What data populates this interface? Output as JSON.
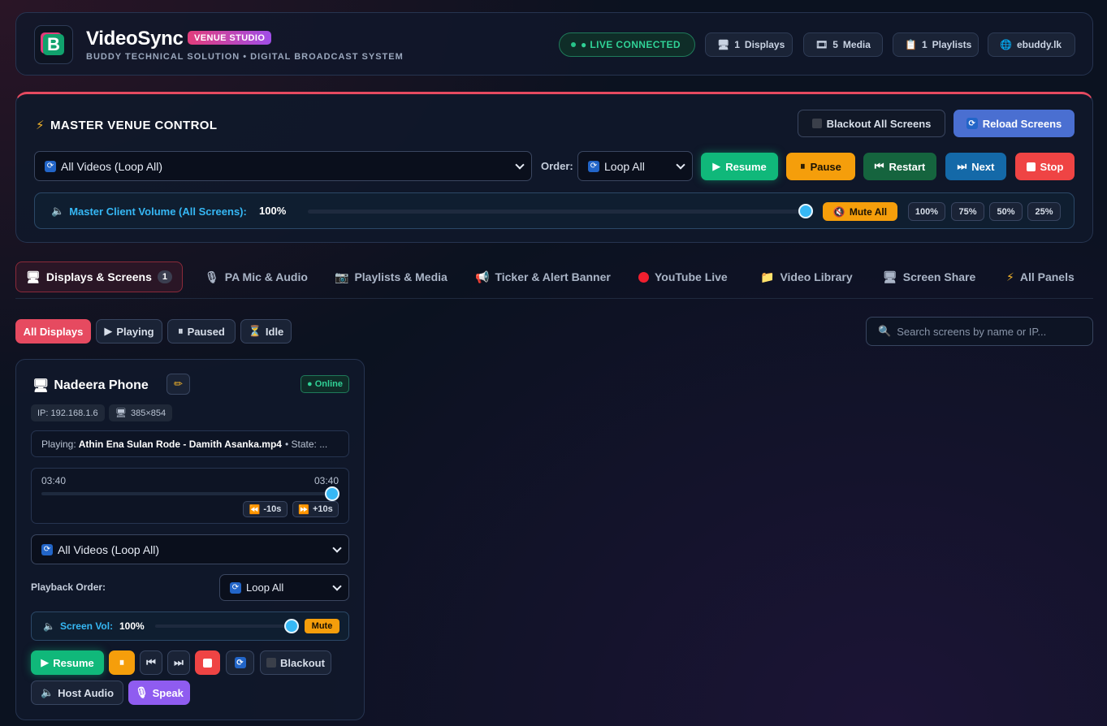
{
  "header": {
    "logo_letter": "B",
    "title": "VideoSync",
    "badge": "VENUE STUDIO",
    "subtitle": "BUDDY TECHNICAL SOLUTION • DIGITAL BROADCAST SYSTEM",
    "live_status": "● LIVE CONNECTED",
    "displays_count": "1",
    "displays_label": "Displays",
    "media_count": "5",
    "media_label": "Media",
    "playlists_count": "1",
    "playlists_label": "Playlists",
    "domain": "ebuddy.lk"
  },
  "master": {
    "title": "MASTER VENUE CONTROL",
    "blackout_label": "Blackout All Screens",
    "reload_label": "Reload Screens",
    "playlist_selected": "All Videos (Loop All)",
    "order_label": "Order:",
    "order_selected": "Loop All",
    "resume_label": "Resume",
    "pause_label": "Pause",
    "restart_label": "Restart",
    "next_label": "Next",
    "stop_label": "Stop",
    "volume_label": "Master Client Volume (All Screens):",
    "volume_value": "100%",
    "volume_level": 1.0,
    "mute_all_label": "Mute All",
    "presets": [
      "100%",
      "75%",
      "50%",
      "25%"
    ]
  },
  "tabs": [
    {
      "label": "Displays & Screens",
      "count": "1",
      "icon": "monitor-icon"
    },
    {
      "label": "PA Mic & Audio",
      "icon": "microphone-icon"
    },
    {
      "label": "Playlists & Media",
      "icon": "camera-icon"
    },
    {
      "label": "Ticker & Alert Banner",
      "icon": "megaphone-icon"
    },
    {
      "label": "YouTube Live",
      "icon": "red-circle-icon"
    },
    {
      "label": "Video Library",
      "icon": "folder-icon"
    },
    {
      "label": "Screen Share",
      "icon": "monitor-icon"
    },
    {
      "label": "All Panels",
      "icon": "bolt-icon"
    }
  ],
  "filters": {
    "all": "All Displays",
    "playing": "Playing",
    "paused": "Paused",
    "idle": "Idle",
    "search_placeholder": "Search screens by name or IP..."
  },
  "display_card": {
    "name": "Nadeera Phone",
    "status": "● Online",
    "ip": "IP: 192.168.1.6",
    "resolution": "385×854",
    "playing_prefix": "Playing:",
    "playing_file": "Athin Ena Sulan Rode - Damith Asanka.mp4",
    "state_text": "• State: ...",
    "time_current": "03:40",
    "time_total": "03:40",
    "progress": 1.0,
    "rewind_label": "-10s",
    "forward_label": "+10s",
    "playlist_selected": "All Videos (Loop All)",
    "order_label": "Playback Order:",
    "order_selected": "Loop All",
    "volume_label": "Screen Vol:",
    "volume_value": "100%",
    "volume_level": 1.0,
    "mute_label": "Mute",
    "resume_label": "Resume",
    "blackout_label": "Blackout",
    "host_audio_label": "Host Audio",
    "speak_label": "Speak"
  },
  "colors": {
    "accent_red": "#e64a60",
    "accent_green": "#10b87a",
    "accent_amber": "#f59e0b",
    "accent_blue": "#36b8f5",
    "background": "#0b1220"
  }
}
